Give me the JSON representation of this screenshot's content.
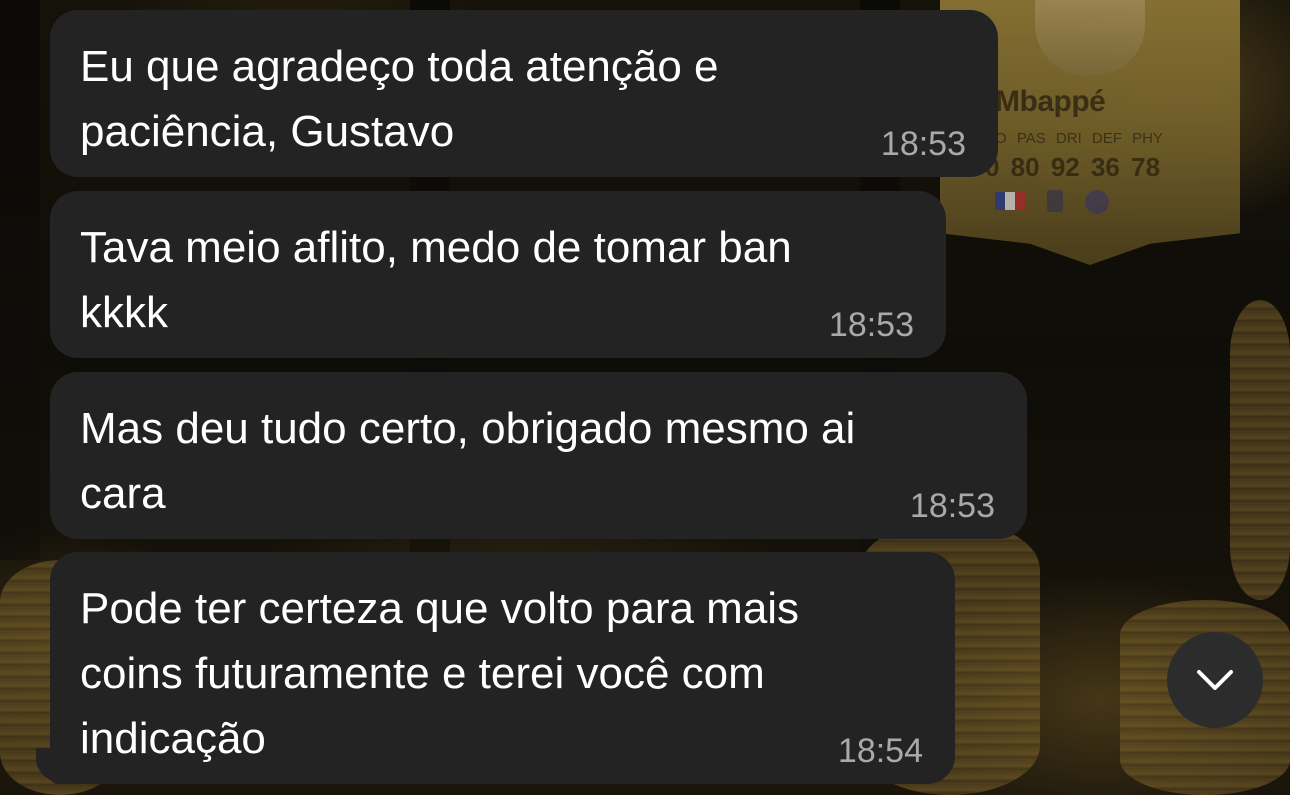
{
  "wallpaper": {
    "card_name": "Mbappé",
    "card_stat_labels": "O PAS DRI DEF PHY",
    "card_stat_values": "0 80 92 36 78"
  },
  "messages": [
    {
      "text": "Eu que agradeço toda atenção e\npaciência, Gustavo",
      "time": "18:53"
    },
    {
      "text": "Tava meio aflito, medo de tomar ban\nkkkk",
      "time": "18:53"
    },
    {
      "text": "Mas deu tudo certo, obrigado mesmo ai\ncara",
      "time": "18:53"
    },
    {
      "text": "Pode ter certeza que volto para mais\ncoins futuramente e terei você com\nindicação",
      "time": "18:54"
    }
  ],
  "controls": {
    "scroll_down_icon": "chevron-down-icon"
  },
  "colors": {
    "bubble": "#232323",
    "text": "#ffffff",
    "timestamp": "#a9a9a9",
    "scroll_button": "#2c2c2c"
  }
}
